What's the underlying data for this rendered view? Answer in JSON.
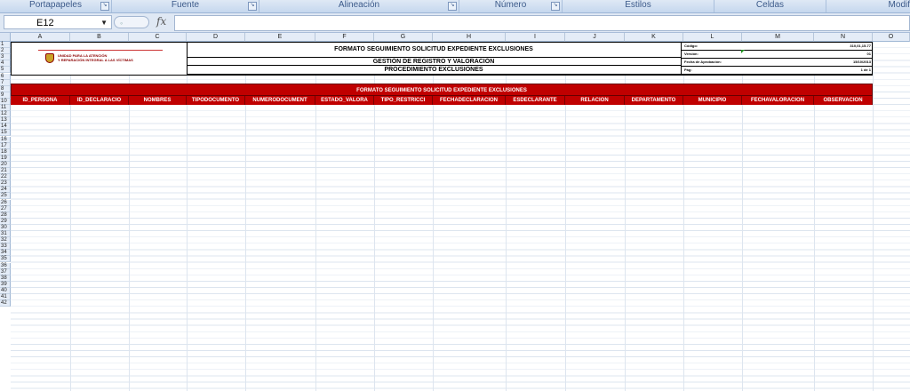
{
  "ribbon": {
    "groups": [
      "Portapapeles",
      "Fuente",
      "Alineación",
      "Número",
      "Estilos",
      "Celdas",
      "Modif"
    ]
  },
  "formula_bar": {
    "name_box": "E12",
    "fx_label": "fx",
    "value": ""
  },
  "columns": [
    "A",
    "B",
    "C",
    "D",
    "E",
    "F",
    "G",
    "H",
    "I",
    "J",
    "K",
    "L",
    "M",
    "N",
    "O"
  ],
  "rows": [
    "1",
    "2",
    "3",
    "4",
    "5",
    "6",
    "7",
    "8",
    "9",
    "10",
    "11",
    "12",
    "13",
    "14",
    "15",
    "16",
    "17",
    "18",
    "19",
    "20",
    "21",
    "22",
    "23",
    "24",
    "25",
    "26",
    "27",
    "28",
    "29",
    "30",
    "31",
    "32",
    "33",
    "34",
    "35",
    "36",
    "37",
    "38",
    "39",
    "40",
    "41",
    "42"
  ],
  "document": {
    "logo_line1": "UNIDAD PARA LA ATENCIÓN",
    "logo_line2": "Y REPARACIÓN INTEGRAL A LAS VÍCTIMAS",
    "title1": "FORMATO SEGUIMIENTO SOLICITUD EXPEDIENTE EXCLUSIONES",
    "title2": "GESTIÓN DE REGISTRO Y VALORACIÓN",
    "title3": "PROCEDIMIENTO EXCLUSIONES",
    "meta": [
      {
        "key": "Código:",
        "value": "310,01,15-77"
      },
      {
        "key": "Versión:",
        "value": "01"
      },
      {
        "key": "Fecha de Aprobación:",
        "value": "15/10/2013"
      },
      {
        "key": "Pág:",
        "value": "1 de 1"
      }
    ]
  },
  "table": {
    "banner": "FORMATO SEGUIMIENTO SOLICITUD EXPEDIENTE EXCLUSIONES",
    "headers": [
      "ID_PERSONA",
      "ID_DECLARACIO",
      "NOMBRES",
      "TIPODOCUMENTO",
      "NUMERODOCUMENT",
      "ESTADO_VALORA",
      "TIPO_RESTRICCI",
      "FECHADECLARACION",
      "ESDECLARANTE",
      "RELACION",
      "DEPARTAMENTO",
      "MUNICIPIO",
      "FECHAVALORACION",
      "OBSERVACION"
    ]
  },
  "colors": {
    "banner_red": "#c00000",
    "ribbon_text": "#3c5a8a"
  }
}
